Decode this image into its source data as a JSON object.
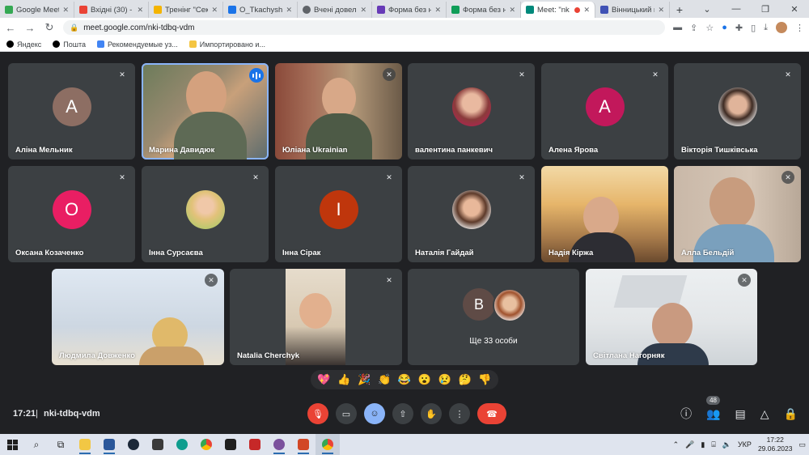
{
  "browser": {
    "tabs": [
      {
        "title": "Google Meet",
        "color": "#34a853",
        "active": false
      },
      {
        "title": "Вхідні (30) - ",
        "color": "#ea4335",
        "active": false
      },
      {
        "title": "Тренінг \"Секр",
        "color": "#f4b400",
        "active": false
      },
      {
        "title": "O_Tkachyshyn",
        "color": "#1a73e8",
        "active": false
      },
      {
        "title": "Вчені довелі",
        "color": "#5f6368",
        "active": false
      },
      {
        "title": "Форма без на",
        "color": "#673ab7",
        "active": false
      },
      {
        "title": "Форма без на",
        "color": "#0f9d58",
        "active": false
      },
      {
        "title": "Meet: \"nk",
        "color": "#00897b",
        "active": true
      },
      {
        "title": "Вінницький к",
        "color": "#3f51b5",
        "active": false
      }
    ],
    "url": "meet.google.com/nki-tdbq-vdm",
    "bookmarks": [
      {
        "label": "Яндекс",
        "color": "#000000"
      },
      {
        "label": "Пошта",
        "color": "#000000"
      },
      {
        "label": "Рекомендуемые уз...",
        "color": "#4285f4"
      },
      {
        "label": "Импортировано и...",
        "color": "#f4c542"
      }
    ]
  },
  "meet": {
    "participants": [
      {
        "name": "Аліна Мельник",
        "initial": "A",
        "avatar_color": "#8d6e63",
        "kind": "initial"
      },
      {
        "name": "Марина Давидюк",
        "kind": "video",
        "speaking": true
      },
      {
        "name": "Юліана Ukrainian",
        "kind": "video"
      },
      {
        "name": "валентина панкевич",
        "kind": "photo"
      },
      {
        "name": "Алена Ярова",
        "initial": "A",
        "avatar_color": "#c2185b",
        "kind": "initial"
      },
      {
        "name": "Вікторія Тишківська",
        "kind": "photo"
      },
      {
        "name": "Оксана Козаченко",
        "initial": "O",
        "avatar_color": "#e91e63",
        "kind": "initial"
      },
      {
        "name": "Інна Сурсаєва",
        "kind": "photo"
      },
      {
        "name": "Інна Сірак",
        "initial": "I",
        "avatar_color": "#bf360c",
        "kind": "initial"
      },
      {
        "name": "Наталія Гайдай",
        "kind": "photo"
      },
      {
        "name": "Надія Кіржа",
        "kind": "video"
      },
      {
        "name": "Алла Бельдій",
        "kind": "video"
      },
      {
        "name": "Людмила Довженко",
        "kind": "video"
      },
      {
        "name": "Natalia Cherchyk",
        "kind": "video"
      },
      {
        "name": "Світлана Нагорняк",
        "kind": "video"
      }
    ],
    "more": {
      "initial": "B",
      "label": "Ще 33 особи"
    },
    "reactions": [
      "💖",
      "👍",
      "🎉",
      "👏",
      "😂",
      "😮",
      "😢",
      "🤔",
      "👎"
    ],
    "time": "17:21",
    "meeting_code": "nki-tdbq-vdm",
    "people_count": "48"
  },
  "taskbar": {
    "lang": "УКР",
    "time": "17:22",
    "date": "29.06.2023"
  }
}
